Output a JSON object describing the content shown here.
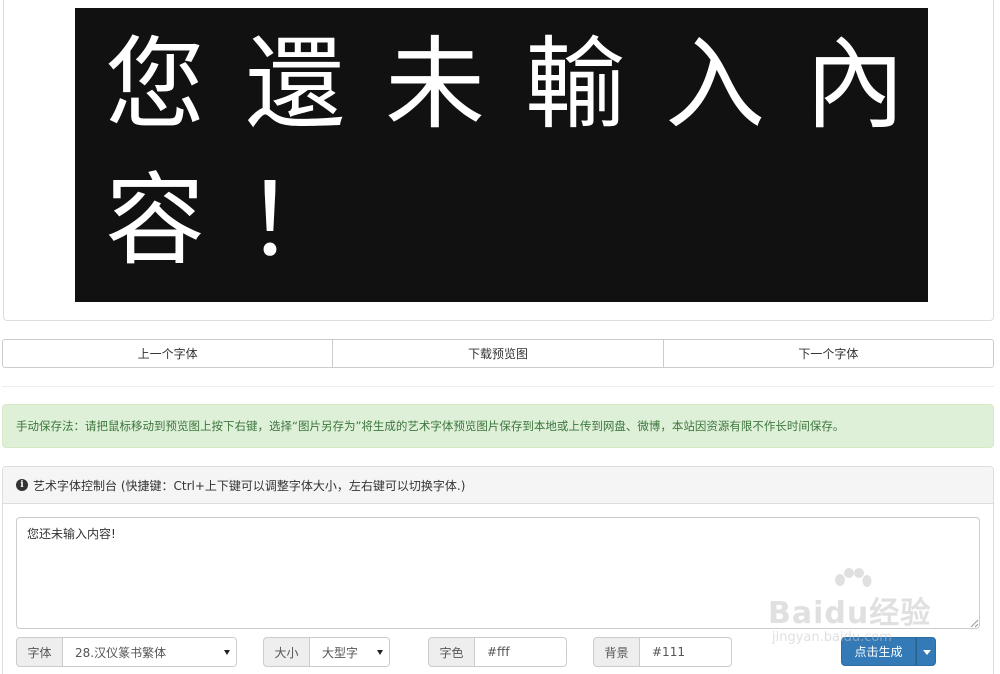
{
  "preview": {
    "line1": "您還未輸入內",
    "line2": "容！",
    "text_color": "#ffffff",
    "bg_color": "#111111"
  },
  "nav": {
    "prev_label": "上一个字体",
    "download_label": "下载预览图",
    "next_label": "下一个字体"
  },
  "notice": {
    "text": "手动保存法：请把鼠标移动到预览图上按下右键，选择“图片另存为”将生成的艺术字体预览图片保存到本地或上传到网盘、微博，本站因资源有限不作长时间保存。"
  },
  "console": {
    "title": "艺术字体控制台 (快捷键：Ctrl+上下键可以调整字体大小，左右键可以切换字体.)",
    "input_value": "您还未输入内容!"
  },
  "controls": {
    "font_label": "字体",
    "font_value": "28.汉仪篆书繁体",
    "size_label": "大小",
    "size_value": "大型字",
    "color_label": "字色",
    "color_value": "#fff",
    "bg_label": "背景",
    "bg_value": "#111",
    "generate_label": "点击生成"
  },
  "watermark": {
    "logo": "Baidu经验",
    "url": "jingyan.baidu.com"
  },
  "colors": {
    "primary": "#337ab7",
    "alert_bg": "#dff0d8",
    "alert_text": "#3c763d"
  }
}
